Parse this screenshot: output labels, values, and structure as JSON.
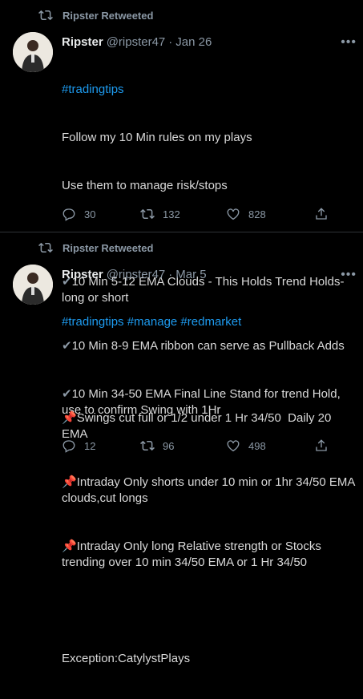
{
  "tweets": [
    {
      "retweet_label": "Ripster Retweeted",
      "name": "Ripster",
      "handle": "@ripster47",
      "date": "Jan 26",
      "hashtags": "#tradingtips",
      "lines": [
        "Follow my 10 Min rules on my plays",
        "Use them to manage risk/stops"
      ],
      "bullets": [
        "10 Min 5-12 EMA Clouds - This Holds Trend Holds- long or short",
        "10 Min 8-9 EMA ribbon can serve as Pullback Adds",
        "10 Min 34-50 EMA Final Line Stand for trend Hold, use to confirm Swing with 1Hr"
      ],
      "bullet_icon": "✔",
      "replies": "30",
      "retweets": "132",
      "likes": "828"
    },
    {
      "retweet_label": "Ripster Retweeted",
      "name": "Ripster",
      "handle": "@ripster47",
      "date": "Mar 5",
      "hashtags": "#tradingtips #manage #redmarket",
      "bullets": [
        "Swings cut full or 1/2 under 1 Hr 34/50  Daily 20 EMA",
        "Intraday Only shorts under 10 min or 1hr 34/50 EMA clouds,cut longs",
        "Intraday Only long Relative strength or Stocks trending over 10 min 34/50 EMA or 1 Hr 34/50"
      ],
      "bullet_icon": "📌",
      "footer": "Exception:CatylystPlays",
      "replies": "12",
      "retweets": "96",
      "likes": "498"
    }
  ],
  "colors": {
    "background": "#000000",
    "link": "#1d9bf0",
    "muted": "#8b98a5"
  },
  "icons": [
    "retweet-icon",
    "reply-icon",
    "like-icon",
    "share-icon",
    "more-icon",
    "check-icon",
    "pin-icon"
  ]
}
